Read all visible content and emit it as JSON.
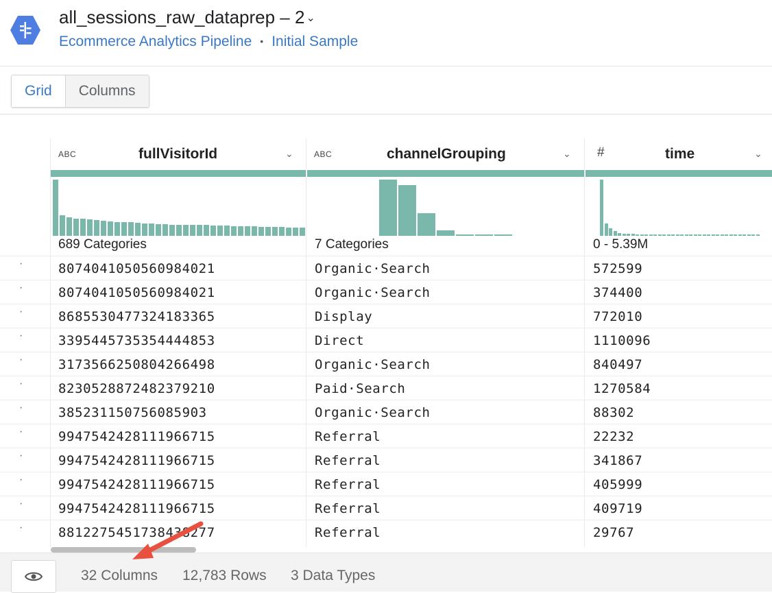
{
  "header": {
    "title": "all_sessions_raw_dataprep – 2",
    "title_chevron": "⌄",
    "flow_link": "Ecommerce Analytics Pipeline",
    "separator": "•",
    "sample_link": "Initial Sample",
    "logo_icon": "dataprep-logo-icon",
    "logo_color": "#4f7ee3"
  },
  "view_toggle": {
    "grid_label": "Grid",
    "columns_label": "Columns",
    "active": "Grid",
    "active_color": "#3b78c4"
  },
  "grid": {
    "accent_color": "#7ab8ab",
    "columns": [
      {
        "type_label": "ABC",
        "name": "fullVisitorId",
        "summary": "689 Categories",
        "histogram": [
          1.0,
          0.36,
          0.33,
          0.31,
          0.3,
          0.29,
          0.28,
          0.27,
          0.26,
          0.25,
          0.24,
          0.24,
          0.23,
          0.22,
          0.22,
          0.21,
          0.21,
          0.2,
          0.2,
          0.2,
          0.19,
          0.19,
          0.19,
          0.18,
          0.18,
          0.18,
          0.17,
          0.17,
          0.17,
          0.17,
          0.16,
          0.16,
          0.16,
          0.16,
          0.15,
          0.15,
          0.15
        ]
      },
      {
        "type_label": "ABC",
        "name": "channelGrouping",
        "summary": "7 Categories",
        "histogram": [
          1.0,
          0.9,
          0.4,
          0.1,
          0.03,
          0.03,
          0.03
        ]
      },
      {
        "type_label": "#",
        "name": "time",
        "summary": "0 - 5.39M",
        "histogram": [
          1.0,
          0.22,
          0.13,
          0.08,
          0.05,
          0.04,
          0.04,
          0.04,
          0.03,
          0.03,
          0.03,
          0.03,
          0.03,
          0.03,
          0.03,
          0.03,
          0.03,
          0.03,
          0.03,
          0.03,
          0.03,
          0.03,
          0.03,
          0.03,
          0.03,
          0.03,
          0.03,
          0.03,
          0.03,
          0.03,
          0.03,
          0.03,
          0.03,
          0.03,
          0.03,
          0.03
        ]
      }
    ],
    "row_marker": "·",
    "rows": [
      [
        "8074041050560984021",
        "Organic·Search",
        "572599"
      ],
      [
        "8074041050560984021",
        "Organic·Search",
        "374400"
      ],
      [
        "8685530477324183365",
        "Display",
        "772010"
      ],
      [
        "3395445735354444853",
        "Direct",
        "1110096"
      ],
      [
        "3173566250804266498",
        "Organic·Search",
        "840497"
      ],
      [
        "8230528872482379210",
        "Paid·Search",
        "1270584"
      ],
      [
        "385231150756085903",
        "Organic·Search",
        "88302"
      ],
      [
        "9947542428111966715",
        "Referral",
        "22232"
      ],
      [
        "9947542428111966715",
        "Referral",
        "341867"
      ],
      [
        "9947542428111966715",
        "Referral",
        "405999"
      ],
      [
        "9947542428111966715",
        "Referral",
        "409719"
      ],
      [
        "8812275451738438277",
        "Referral",
        "29767"
      ]
    ]
  },
  "footer": {
    "eye_icon": "eye-icon",
    "columns_count": "32 Columns",
    "rows_count": "12,783 Rows",
    "types_count": "3 Data Types"
  },
  "annotation": {
    "arrow_color": "#e8503f"
  }
}
